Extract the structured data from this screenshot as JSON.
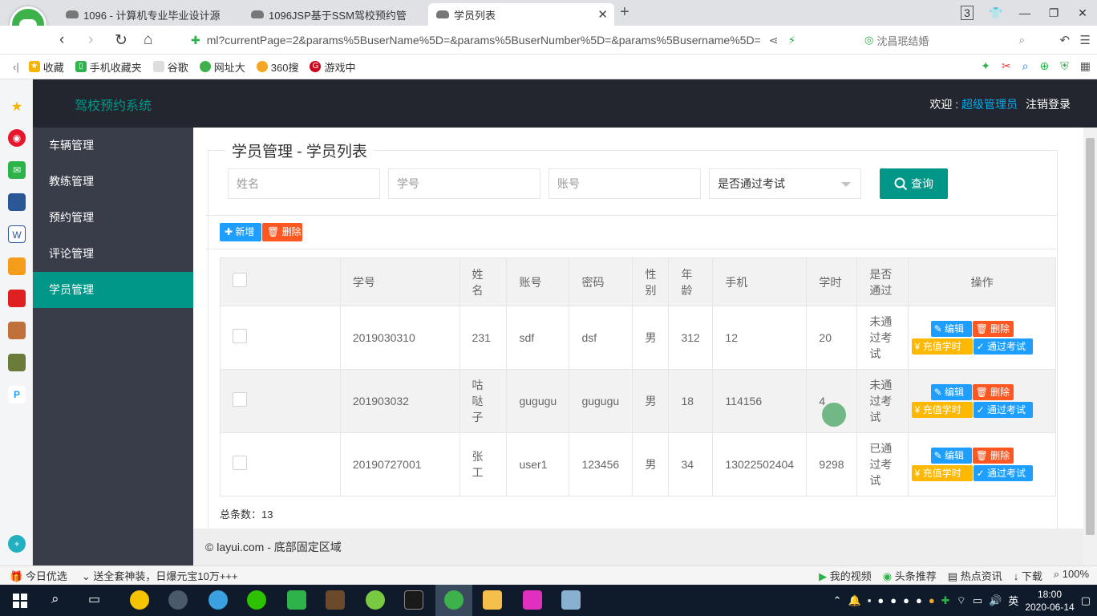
{
  "browser": {
    "tabs": [
      {
        "title": "1096 - 计算机专业毕业设计源"
      },
      {
        "title": "1096JSP基于SSM驾校预约管"
      },
      {
        "title": "学员列表"
      }
    ],
    "tab_count_badge": "3",
    "url": "ml?currentPage=2&params%5BuserName%5D=&params%5BuserNumber%5D=&params%5Busername%5D=",
    "search_text": "沈昌珉结婚",
    "bookmarks": [
      "收藏",
      "手机收藏夹",
      "谷歌",
      "网址大",
      "360搜",
      "游戏中"
    ]
  },
  "app": {
    "title": "驾校预约系统",
    "welcome_prefix": "欢迎 : ",
    "user": "超级管理员",
    "logout": "注销登录",
    "menu": [
      {
        "label": "车辆管理"
      },
      {
        "label": "教练管理"
      },
      {
        "label": "预约管理"
      },
      {
        "label": "评论管理"
      },
      {
        "label": "学员管理"
      }
    ]
  },
  "filters": {
    "legend": "学员管理 - 学员列表",
    "name_placeholder": "姓名",
    "number_placeholder": "学号",
    "account_placeholder": "账号",
    "pass_select": "是否通过考试",
    "query_label": "查询"
  },
  "toolbar": {
    "add_label": "新增",
    "delete_label": "删除"
  },
  "table": {
    "headers": {
      "number": "学号",
      "name": "姓名",
      "account": "账号",
      "password": "密码",
      "gender": "性别",
      "age": "年龄",
      "phone": "手机",
      "hours": "学时",
      "passed": "是否通过",
      "actions": "操作"
    },
    "rows": [
      {
        "number": "2019030310",
        "name": "231",
        "account": "sdf",
        "password": "dsf",
        "gender": "男",
        "age": "312",
        "phone": "12",
        "hours": "20",
        "passed": "未通过考试"
      },
      {
        "number": "201903032",
        "name": "咕哒子",
        "account": "gugugu",
        "password": "gugugu",
        "gender": "男",
        "age": "18",
        "phone": "114156",
        "hours": "4",
        "passed": "未通过考试"
      },
      {
        "number": "20190727001",
        "name": "张工",
        "account": "user1",
        "password": "123456",
        "gender": "男",
        "age": "34",
        "phone": "13022502404",
        "hours": "9298",
        "passed": "已通过考试"
      }
    ],
    "row_actions": {
      "edit": "编辑",
      "delete": "删除",
      "recharge": "充值学时",
      "pass": "通过考试"
    },
    "total_label": "总条数：13"
  },
  "footer": "© layui.com - 底部固定区域",
  "statusbar": {
    "left": [
      "今日优选",
      "送全套神装，日爆元宝10万+++"
    ],
    "right": [
      "我的视频",
      "头条推荐",
      "热点资讯",
      "下载",
      "100%"
    ]
  },
  "taskbar": {
    "time": "18:00",
    "date": "2020-06-14",
    "ime": "英"
  },
  "colors": {
    "primary": "#009688",
    "normal": "#1e9fff",
    "danger": "#ff5722",
    "warm": "#ffb800",
    "header": "#23262e",
    "side": "#393d49"
  }
}
